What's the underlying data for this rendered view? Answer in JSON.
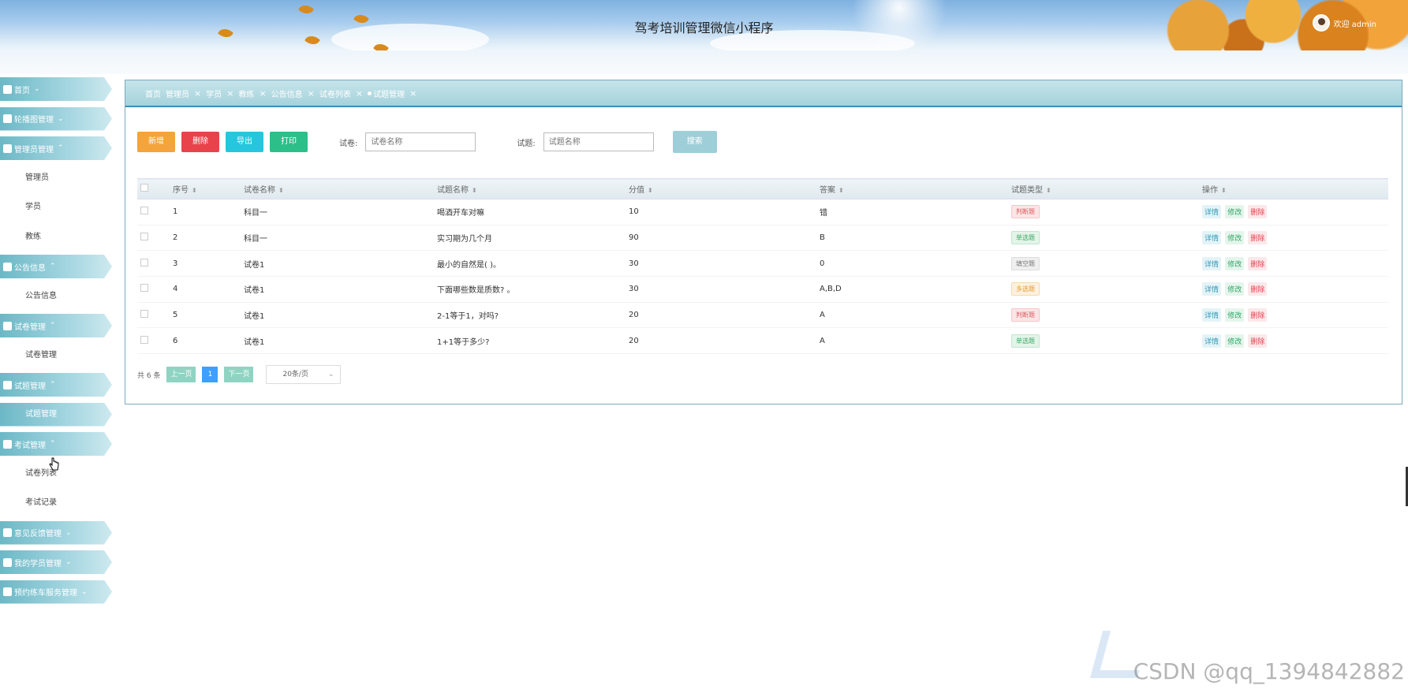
{
  "header": {
    "title": "驾考培训管理微信小程序",
    "welcome": "欢迎 admin"
  },
  "sidebar": {
    "items": [
      {
        "type": "group",
        "label": "首页",
        "chev": "⌄",
        "icon": "home-icon"
      },
      {
        "type": "group",
        "label": "轮播图管理",
        "chev": "⌄",
        "icon": "grid-icon"
      },
      {
        "type": "group",
        "label": "管理员管理",
        "chev": "⌃",
        "icon": "car-icon"
      },
      {
        "type": "sub",
        "label": "管理员"
      },
      {
        "type": "sub",
        "label": "学员"
      },
      {
        "type": "sub",
        "label": "教练"
      },
      {
        "type": "group",
        "label": "公告信息",
        "chev": "⌃",
        "icon": "grid-icon"
      },
      {
        "type": "sub",
        "label": "公告信息"
      },
      {
        "type": "group",
        "label": "试卷管理",
        "chev": "⌃",
        "icon": "gear-icon"
      },
      {
        "type": "sub",
        "label": "试卷管理"
      },
      {
        "type": "group",
        "label": "试题管理",
        "chev": "⌃",
        "icon": "doc-icon"
      },
      {
        "type": "sub",
        "label": "试题管理",
        "active": true
      },
      {
        "type": "group",
        "label": "考试管理",
        "chev": "⌃",
        "icon": "grid-icon"
      },
      {
        "type": "sub",
        "label": "试卷列表"
      },
      {
        "type": "sub",
        "label": "考试记录"
      },
      {
        "type": "group",
        "label": "意见反馈管理",
        "chev": "⌄",
        "icon": "book-icon"
      },
      {
        "type": "group",
        "label": "我的学员管理",
        "chev": "⌄",
        "icon": "grid-icon"
      },
      {
        "type": "group",
        "label": "预约练车服务管理",
        "chev": "⌄",
        "icon": "car-icon"
      }
    ]
  },
  "tabs": [
    {
      "label": "首页",
      "closable": false
    },
    {
      "label": "管理员",
      "closable": true
    },
    {
      "label": "学员",
      "closable": true
    },
    {
      "label": "教练",
      "closable": true
    },
    {
      "label": "公告信息",
      "closable": true
    },
    {
      "label": "试卷列表",
      "closable": true
    },
    {
      "label": "试题管理",
      "closable": true,
      "active": true
    }
  ],
  "toolbar": {
    "add": "新增",
    "delete": "删除",
    "export": "导出",
    "print": "打印",
    "paper_label": "试卷:",
    "paper_placeholder": "试卷名称",
    "question_label": "试题:",
    "question_placeholder": "试题名称",
    "search": "搜索"
  },
  "table": {
    "columns": [
      "序号",
      "试卷名称",
      "试题名称",
      "分值",
      "答案",
      "试题类型",
      "操作"
    ],
    "rows": [
      {
        "no": "1",
        "paper": "科目一",
        "question": "喝酒开车对嘛",
        "score": "10",
        "answer": "错",
        "type": "判断题",
        "tag": "judge"
      },
      {
        "no": "2",
        "paper": "科目一",
        "question": "实习期为几个月",
        "score": "90",
        "answer": "B",
        "type": "单选题",
        "tag": "single"
      },
      {
        "no": "3",
        "paper": "试卷1",
        "question": "最小的自然是( )。",
        "score": "30",
        "answer": "0",
        "type": "填空题",
        "tag": "fill"
      },
      {
        "no": "4",
        "paper": "试卷1",
        "question": "下面哪些数是质数? 。",
        "score": "30",
        "answer": "A,B,D",
        "type": "多选题",
        "tag": "multi"
      },
      {
        "no": "5",
        "paper": "试卷1",
        "question": "2-1等于1，对吗?",
        "score": "20",
        "answer": "A",
        "type": "判断题",
        "tag": "judge"
      },
      {
        "no": "6",
        "paper": "试卷1",
        "question": "1+1等于多少?",
        "score": "20",
        "answer": "A",
        "type": "单选题",
        "tag": "single"
      }
    ],
    "actions": {
      "detail": "详情",
      "edit": "修改",
      "delete": "删除"
    }
  },
  "pager": {
    "total": "共 6 条",
    "prev": "上一页",
    "current": "1",
    "next": "下一页",
    "page_size": "20条/页"
  },
  "watermark": "CSDN @qq_1394842882"
}
